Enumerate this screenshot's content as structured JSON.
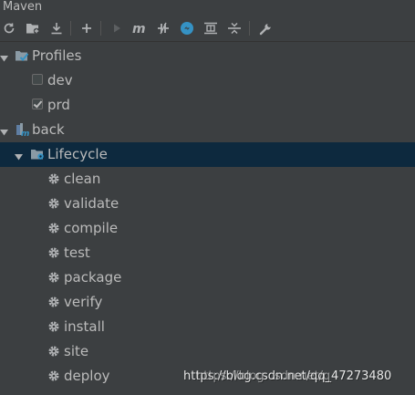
{
  "window": {
    "title": "Maven"
  },
  "toolbar": {
    "buttons": [
      {
        "name": "reload-icon"
      },
      {
        "name": "add-maven-project-icon"
      },
      {
        "name": "download-sources-icon"
      },
      {
        "name": "plus-icon"
      },
      {
        "name": "run-icon"
      },
      {
        "name": "execute-goal-icon"
      },
      {
        "name": "toggle-offline-icon"
      },
      {
        "name": "skip-tests-icon"
      },
      {
        "name": "show-dependencies-icon"
      },
      {
        "name": "collapse-all-icon"
      },
      {
        "name": "settings-wrench-icon"
      }
    ]
  },
  "tree": {
    "profiles": {
      "label": "Profiles",
      "items": [
        {
          "label": "dev",
          "checked": false
        },
        {
          "label": "prd",
          "checked": true
        }
      ]
    },
    "project": {
      "label": "back",
      "lifecycle": {
        "label": "Lifecycle",
        "goals": [
          "clean",
          "validate",
          "compile",
          "test",
          "package",
          "verify",
          "install",
          "site",
          "deploy"
        ]
      }
    }
  },
  "watermark": {
    "text": "https://blog.csdn.net/qq_47273480",
    "ghost": "https://blog.csdn.net/q"
  },
  "colors": {
    "background": "#3c3f41",
    "selection": "#0d293e",
    "text": "#bbbbbb",
    "icon_blue": "#3592c4",
    "icon_grey": "#afb1b3"
  }
}
